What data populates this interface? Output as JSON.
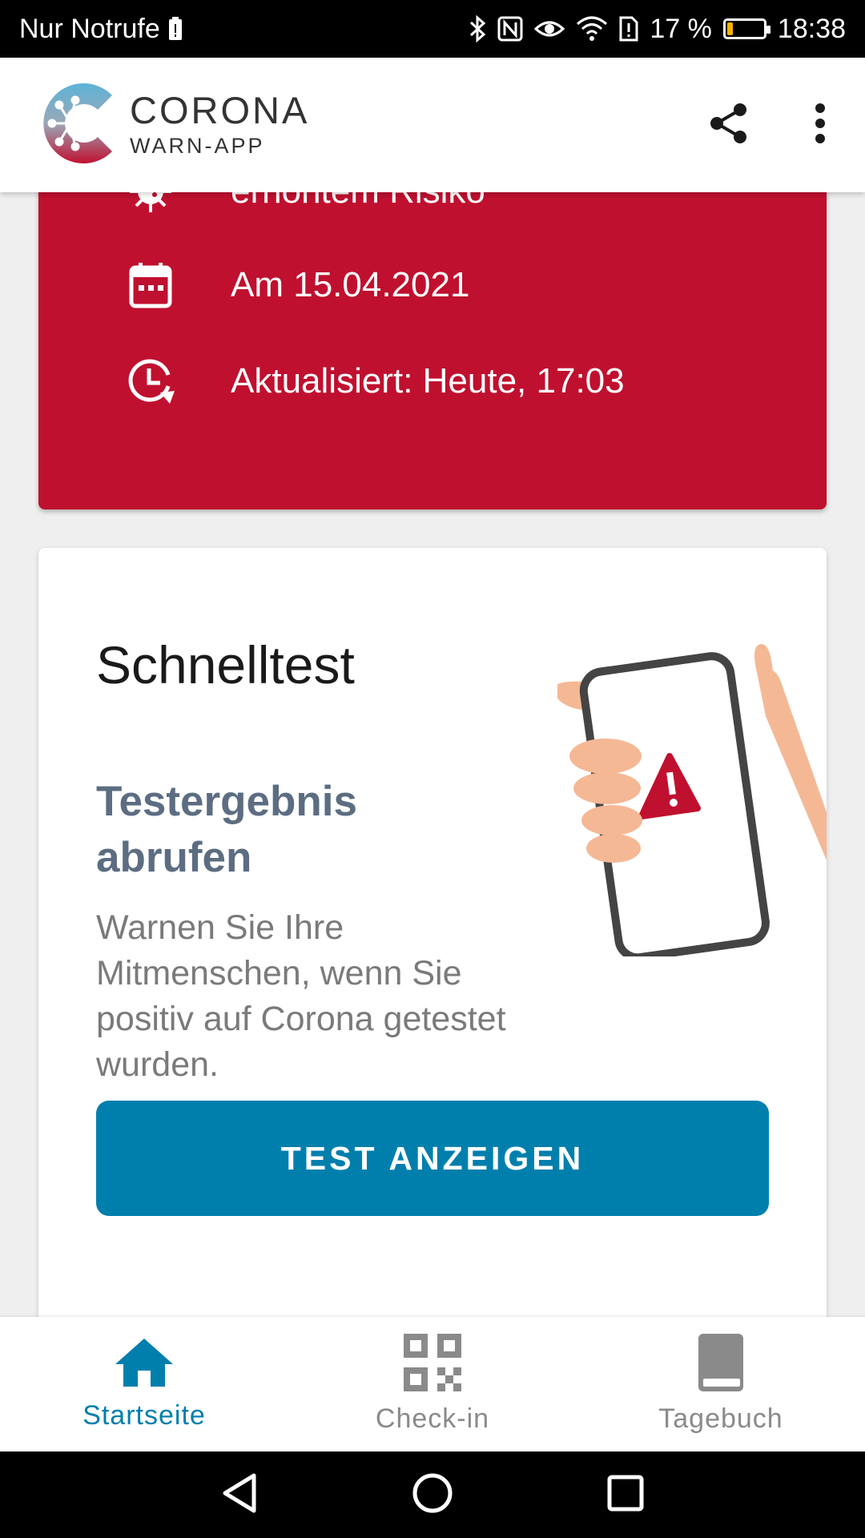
{
  "status_bar": {
    "carrier": "Nur Notrufe",
    "battery_percent": "17 %",
    "battery_level": 0.17,
    "time": "18:38"
  },
  "app_bar": {
    "logo_title": "CORONA",
    "logo_subtitle": "WARN-APP",
    "share_icon": "share-icon",
    "menu_icon": "more-vert-icon"
  },
  "risk_card": {
    "color": "#c0102f",
    "rows": [
      {
        "icon": "virus-icon",
        "text": "erhöhtem Risiko"
      },
      {
        "icon": "calendar-icon",
        "text": "Am 15.04.2021"
      },
      {
        "icon": "clock-refresh-icon",
        "text": "Aktualisiert: Heute, 17:03"
      }
    ]
  },
  "test_card": {
    "title": "Schnelltest",
    "subtitle": "Testergebnis abrufen",
    "description": "Warnen Sie Ihre Mitmenschen, wenn Sie positiv auf Corona getestet wurden.",
    "button_label": "TEST ANZEIGEN",
    "accent_color": "#007fad"
  },
  "bottom_nav": {
    "items": [
      {
        "icon": "home-icon",
        "label": "Startseite",
        "active": true
      },
      {
        "icon": "qr-code-icon",
        "label": "Check-in",
        "active": false
      },
      {
        "icon": "book-icon",
        "label": "Tagebuch",
        "active": false
      }
    ]
  },
  "system_nav": {
    "back": "back-icon",
    "home": "home-circle-icon",
    "recents": "recents-icon"
  }
}
